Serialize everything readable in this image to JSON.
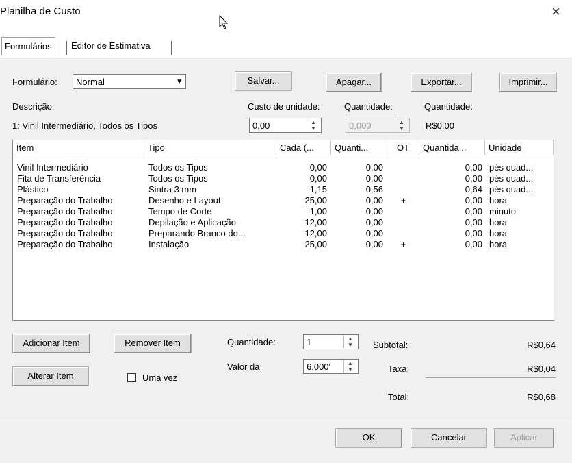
{
  "window": {
    "title": "Planilha de Custo",
    "close": "×"
  },
  "tabs": [
    {
      "label": "Formulários",
      "active": true
    },
    {
      "label": "Editor de Estimativa",
      "active": false
    }
  ],
  "form": {
    "formulario_label": "Formulário:",
    "formulario_value": "Normal",
    "descricao_label": "Descrição:",
    "descricao_value": "1: Vinil Intermediário, Todos os Tipos",
    "custo_unidade_label": "Custo de unidade:",
    "custo_unidade_value": "0,00",
    "quantidade_label": "Quantidade:",
    "quantidade_value": "0,000",
    "quantidade2_label": "Quantidade:",
    "quantidade2_value": "R$0,00"
  },
  "toolbar": {
    "salvar": "Salvar...",
    "apagar": "Apagar...",
    "exportar": "Exportar...",
    "imprimir": "Imprimir..."
  },
  "table": {
    "columns": [
      "Item",
      "Tipo",
      "Cada (...",
      "Quanti...",
      "OT",
      "Quantida...",
      "Unidade"
    ],
    "rows": [
      [
        "Vinil Intermediário",
        "Todos os Tipos",
        "0,00",
        "0,00",
        "",
        "0,00",
        "pés quad..."
      ],
      [
        "Fita de Transferência",
        "Todos os Tipos",
        "0,00",
        "0,00",
        "",
        "0,00",
        "pés quad..."
      ],
      [
        "Plástico",
        "Sintra 3 mm",
        "1,15",
        "0,56",
        "",
        "0,64",
        "pés quad..."
      ],
      [
        "Preparação do Trabalho",
        "Desenho e Layout",
        "25,00",
        "0,00",
        "+",
        "0,00",
        "hora"
      ],
      [
        "Preparação do Trabalho",
        "Tempo de Corte",
        "1,00",
        "0,00",
        "",
        "0,00",
        "minuto"
      ],
      [
        "Preparação do Trabalho",
        "Depilação e Aplicação",
        "12,00",
        "0,00",
        "",
        "0,00",
        "hora"
      ],
      [
        "Preparação do Trabalho",
        "Preparando Branco do...",
        "12,00",
        "0,00",
        "",
        "0,00",
        "hora"
      ],
      [
        "Preparação do Trabalho",
        "Instalação",
        "25,00",
        "0,00",
        "+",
        "0,00",
        "hora"
      ]
    ]
  },
  "actions": {
    "adicionar": "Adicionar Item",
    "remover": "Remover Item",
    "alterar": "Alterar Item",
    "uma_vez": "Uma vez"
  },
  "totals": {
    "quantidade_label": "Quantidade:",
    "quantidade_value": "1",
    "valor_label": "Valor da",
    "valor_value": "6,000'",
    "subtotal_label": "Subtotal:",
    "subtotal_value": "R$0,64",
    "taxa_label": "Taxa:",
    "taxa_value": "R$0,04",
    "total_label": "Total:",
    "total_value": "R$0,68"
  },
  "dialog_buttons": {
    "ok": "OK",
    "cancelar": "Cancelar",
    "aplicar": "Aplicar"
  }
}
